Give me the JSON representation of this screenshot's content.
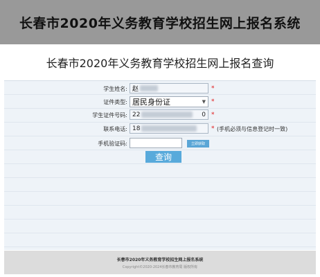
{
  "banner": {
    "title": "长春市2020年义务教育学校招生网上报名系统"
  },
  "page": {
    "subtitle": "长春市2020年义务教育学校招生网上报名查询"
  },
  "form": {
    "student_name": {
      "label": "学生姓名:",
      "value": "赵"
    },
    "id_type": {
      "label": "证件类型:",
      "value": "居民身份证"
    },
    "id_number": {
      "label": "学生证件号码:",
      "value_start": "22",
      "value_end": "0"
    },
    "phone": {
      "label": "联系电话:",
      "value": "18",
      "hint": "(手机必须与信息登记时一致)"
    },
    "sms_code": {
      "label": "手机验证码:",
      "button": "立即获取"
    },
    "required_mark": "*",
    "submit_label": "查询"
  },
  "footer": {
    "line1": "长春市2020年义务教育学校招生网上报名系统",
    "line2": "Copyright©2020-2024长春市教育局 版权所有"
  },
  "colors": {
    "banner_bg": "#999999",
    "form_bg": "#eef3f8",
    "button_bg": "#58aadb",
    "required": "#e11414"
  }
}
